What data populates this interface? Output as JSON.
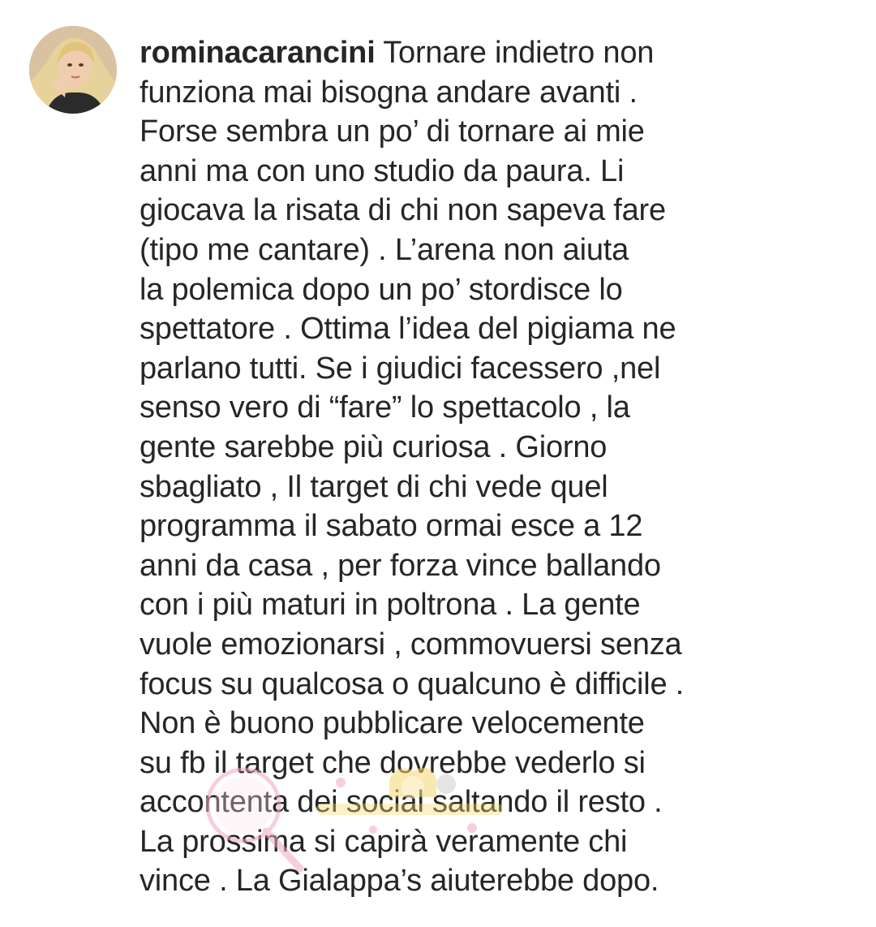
{
  "comment": {
    "username": "rominacarancini",
    "lines": [
      " Tornare indietro non",
      "funziona mai bisogna andare  avanti .",
      "Forse sembra un po’ di tornare ai mie",
      "anni ma con uno studio da paura. Li",
      "giocava la risata di chi non sapeva fare",
      "(tipo me cantare) . L’arena non aiuta",
      "la polemica dopo un po’ stordisce lo",
      "spettatore . Ottima  l’idea del pigiama ne",
      "parlano tutti. Se i giudici facessero ,nel",
      "senso vero di “fare” lo spettacolo , la",
      "gente sarebbe più curiosa . Giorno",
      "sbagliato , Il target di chi vede quel",
      "programma il sabato ormai esce a 12",
      "anni da casa , per forza vince ballando",
      "con i più maturi in poltrona . La gente",
      "vuole emozionarsi , commovuersi senza",
      "focus su qualcosa o qualcuno è difficile .",
      "Non è buono pubblicare velocemente",
      "su fb il target che dovrebbe vederlo si",
      "accontenta dei social saltando il resto .",
      "La prossima si capirà veramente chi",
      "vince . La Gialappa’s aiuterebbe dopo."
    ]
  },
  "icons": {
    "avatar": "profile-photo",
    "watermark": "decorative-watermark-logo"
  },
  "colors": {
    "text": "#262626",
    "background": "#ffffff",
    "watermark_pink": "#f2a7c3",
    "watermark_yellow": "#f5d76e"
  }
}
